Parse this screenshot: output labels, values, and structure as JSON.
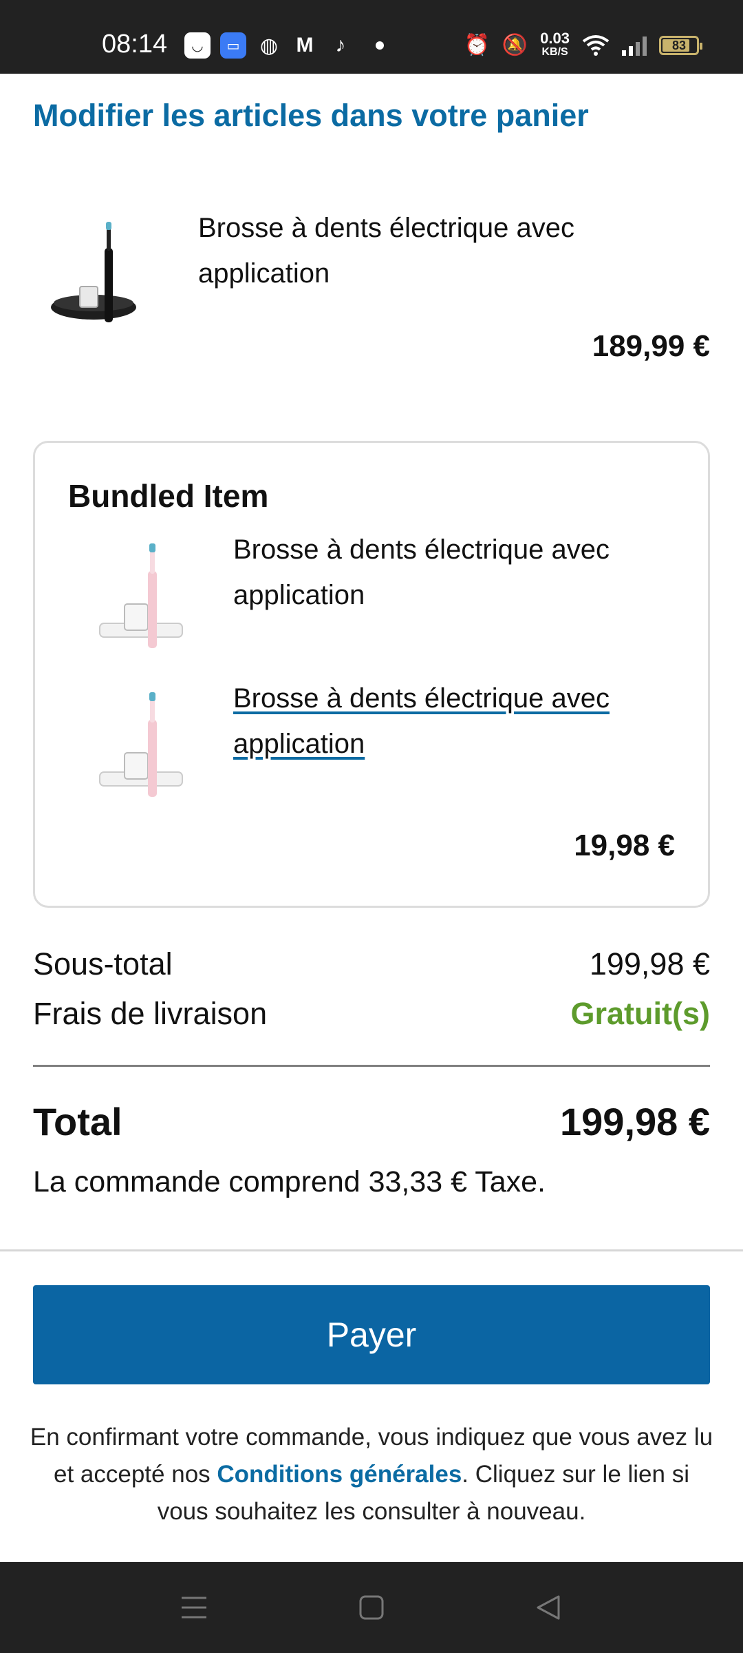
{
  "status_bar": {
    "time": "08:14",
    "network_speed": "0.03",
    "network_speed_unit": "KB/S",
    "battery_level": "83",
    "icons": [
      "smile-app-icon",
      "message-app-icon",
      "cooking-app-icon",
      "gmail-icon",
      "music-app-icon",
      "dot-icon",
      "alarm-icon",
      "mute-icon",
      "wifi-icon",
      "signal-icon",
      "battery-icon"
    ]
  },
  "cart": {
    "title": "Modifier les articles dans votre panier",
    "main_item": {
      "name": "Brosse à dents électrique avec application",
      "price": "189,99 €",
      "image": "black-toothbrush-image"
    },
    "bundle": {
      "title": "Bundled Item",
      "items": [
        {
          "name": "Brosse à dents électrique avec application",
          "image": "pink-toothbrush-image"
        },
        {
          "name": "Brosse à dents électrique avec application",
          "image": "pink-toothbrush-image"
        }
      ],
      "price": "19,98 €"
    }
  },
  "summary": {
    "subtotal_label": "Sous-total",
    "subtotal_value": "199,98 €",
    "shipping_label": "Frais de livraison",
    "shipping_value": "Gratuit(s)",
    "total_label": "Total",
    "total_value": "199,98 €",
    "tax_note": "La commande comprend 33,33 € Taxe."
  },
  "checkout": {
    "pay_button": "Payer",
    "legal_before": "En confirmant votre commande, vous indiquez que vous avez lu et accepté nos ",
    "legal_link": "Conditions générales",
    "legal_after": ". Cliquez sur le lien si vous souhaitez les consulter à nouveau."
  },
  "colors": {
    "accent": "#0b65a3",
    "free_shipping": "#5d9b2c",
    "bars": "#222222"
  }
}
